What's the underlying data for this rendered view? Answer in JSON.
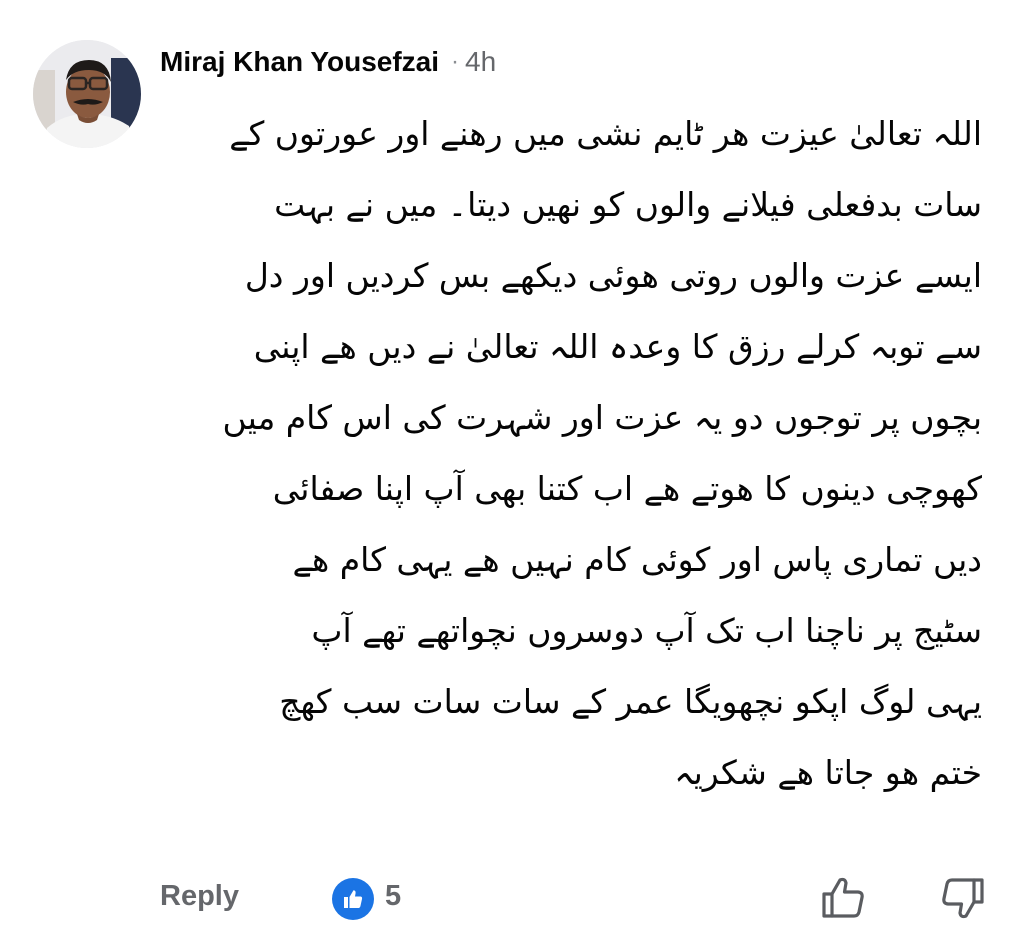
{
  "comment": {
    "author": "Miraj Khan Yousefzai",
    "separator": "·",
    "time": "4h",
    "lines": [
      "اللہ تعالیٰ عیزت ھر ٹایم نشی میں رھنے اور عورتوں کے",
      "سات بدفعلی فیلانے والوں کو نھیں دیتا۔ میں نے بہت",
      "ایسے عزت والوں روتی ھوئی دیکھے بس کردیں اور دل",
      "سے توبہ کرلے رزق کا وعدہ اللہ تعالیٰ نے دیں ھے اپنی",
      "بچوں پر توجوں دو یہ عزت اور شہرت کی اس کام میں",
      "کھوچی دینوں کا ھوتے ھے اب کتنا بھی آپ اپنا صفائی",
      "دیں تماری پاس اور کوئی کام نہیں ھے یہی کام ھے",
      "سٹیج پر ناچنا اب تک آپ دوسروں نچواتھے تھے آپ",
      "یہی لوگ اپکو نچھویگا عمر کے سات سات سب کھچ",
      "ختم ھو جاتا ھے شکریہ"
    ]
  },
  "actions": {
    "reply_label": "Reply",
    "like_count": "5",
    "like_icon": "thumbs-up-icon",
    "upvote_icon": "upvote-icon",
    "downvote_icon": "downvote-icon",
    "like_color": "#1b74e4"
  }
}
